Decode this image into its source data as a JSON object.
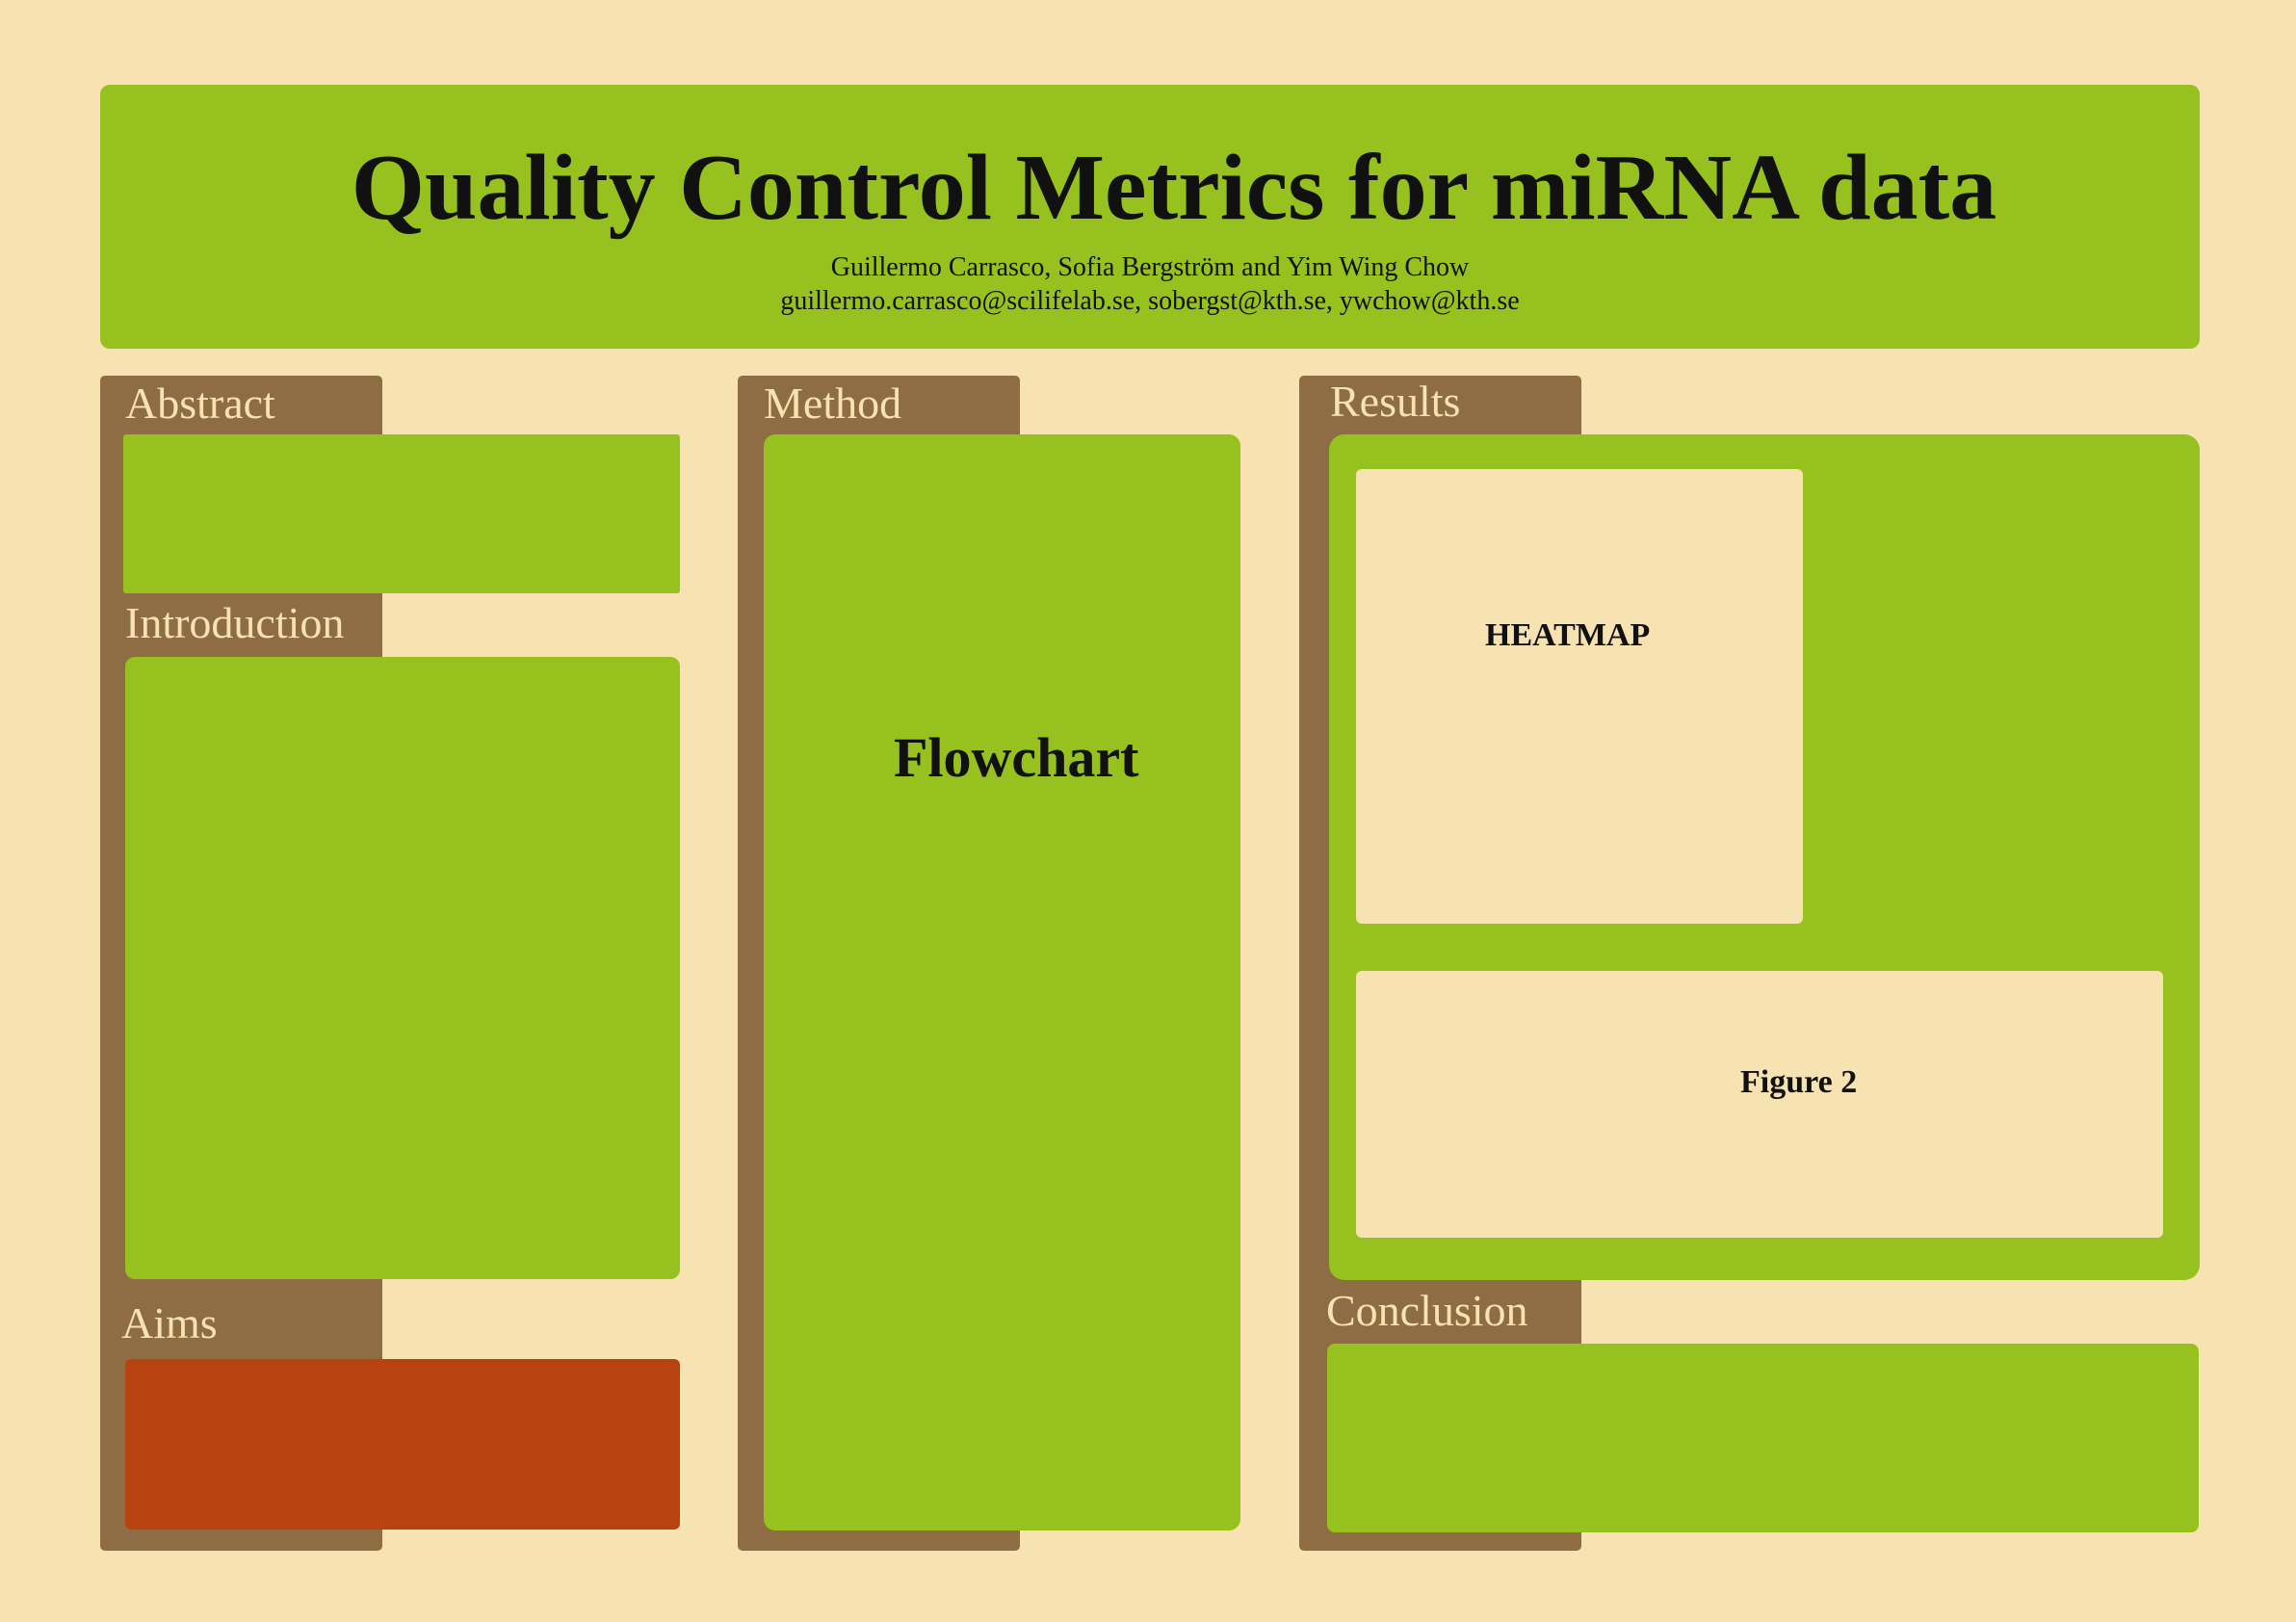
{
  "poster": {
    "title": "Quality Control Metrics for miRNA data",
    "authors": "Guillermo Carrasco, Sofia Bergström and Yim Wing Chow",
    "emails": "guillermo.carrasco@scilifelab.se, sobergst@kth.se, ywchow@kth.se"
  },
  "sections": {
    "abstract": "Abstract",
    "introduction": "Introduction",
    "aims": "Aims",
    "method": "Method",
    "results": "Results",
    "conclusion": "Conclusion"
  },
  "placeholders": {
    "flowchart": "Flowchart",
    "heatmap": "HEATMAP",
    "figure2": "Figure 2"
  },
  "colors": {
    "background": "#f7e2b1",
    "panel_green": "#96c11f",
    "tab_brown": "#8e6d44",
    "aims_box": "#b84311",
    "text_dark": "#111111"
  }
}
